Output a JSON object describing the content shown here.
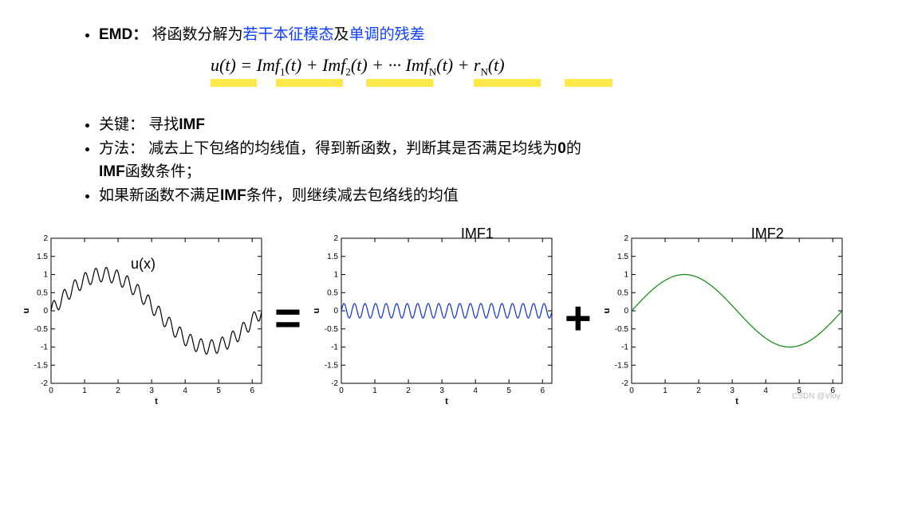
{
  "bullets": {
    "emd_label": "EMD：",
    "emd_text_before": " 将函数分解为",
    "emd_blue1": "若干本征模态",
    "emd_mid": "及",
    "emd_blue2": "单调的残差",
    "key": "关键： 寻找",
    "key_bold": "IMF",
    "method": "方法： 减去上下包络的均线值，得到新函数，判断其是否满足均线为",
    "method_bold_zero": "0",
    "method_tail": "的",
    "method_line2_bold": "IMF",
    "method_line2": "函数条件；",
    "cont": "如果新函数不满足",
    "cont_bold": "IMF",
    "cont_tail": "条件，则继续减去包络线的均值"
  },
  "equation": {
    "u": "u(t)",
    "eq": " = ",
    "imf1": "Imf",
    "s1": "1",
    "t1": "(t)",
    "plus": " + ",
    "imf2": "Imf",
    "s2": "2",
    "t2": "(t)",
    "dots": " + ··· ",
    "imfN": "Imf",
    "sN": "N",
    "tN": "(t)",
    "plus2": " + ",
    "r": "r",
    "rN": "N",
    "rt": "(t)"
  },
  "charts": {
    "op_eq": "=",
    "op_plus": "+",
    "label_u": "u(x)",
    "label_imf1": "IMF1",
    "label_imf2": "IMF2",
    "watermark": "CSDN @Vloy"
  },
  "chart_data": [
    {
      "type": "line",
      "name": "u(x)",
      "color": "#000",
      "formula": "sin(x) + 0.2*sin(20*x)",
      "xlabel": "t",
      "ylabel": "u",
      "xlim": [
        0,
        6.28
      ],
      "ylim": [
        -2,
        2
      ],
      "yticks": [
        -2,
        -1.5,
        -1,
        -0.5,
        0,
        0.5,
        1,
        1.5,
        2
      ],
      "xticks": [
        0,
        1,
        2,
        3,
        4,
        5,
        6
      ]
    },
    {
      "type": "line",
      "name": "IMF1",
      "color": "#1030d0",
      "formula": "0.2*sin(20*x)",
      "xlabel": "t",
      "ylabel": "u",
      "xlim": [
        0,
        6.28
      ],
      "ylim": [
        -2,
        2
      ],
      "yticks": [
        -2,
        -1.5,
        -1,
        -0.5,
        0,
        0.5,
        1,
        1.5,
        2
      ],
      "xticks": [
        0,
        1,
        2,
        3,
        4,
        5,
        6
      ]
    },
    {
      "type": "line",
      "name": "IMF2",
      "color": "#0a8a0a",
      "formula": "sin(x)",
      "xlabel": "t",
      "ylabel": "u",
      "xlim": [
        0,
        6.28
      ],
      "ylim": [
        -2,
        2
      ],
      "yticks": [
        -2,
        -1.5,
        -1,
        -0.5,
        0,
        0.5,
        1,
        1.5,
        2
      ],
      "xticks": [
        0,
        1,
        2,
        3,
        4,
        5,
        6
      ]
    }
  ]
}
